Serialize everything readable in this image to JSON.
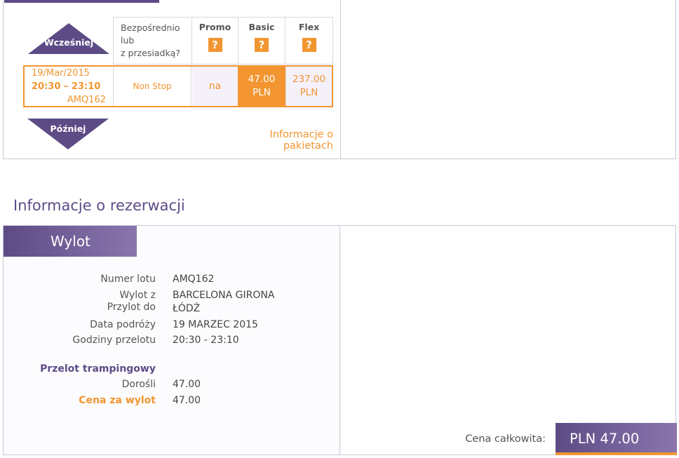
{
  "flight_selector": {
    "earlier_label": "Wcześniej",
    "later_label": "Później",
    "columns": {
      "direct_header": [
        "Bezpośrednio",
        "lub",
        "z przesiadką?"
      ],
      "promo": "Promo",
      "basic": "Basic",
      "flex": "Flex",
      "help_symbol": "?"
    },
    "flight": {
      "date": "19/Mar/2015",
      "time": "20:30 – 23:10",
      "number": "AMQ162",
      "stops": "Non Stop",
      "promo_price": "na",
      "basic_price": "47.00",
      "basic_currency": "PLN",
      "flex_price": "237.00",
      "flex_currency": "PLN"
    },
    "package_info_link": "Informacje o pakietach"
  },
  "booking": {
    "section_title": "Informacje o rezerwacji",
    "tab_label": "Wylot",
    "rows": {
      "flight_number_label": "Numer lotu",
      "flight_number_value": "AMQ162",
      "from_label": "Wylot z",
      "from_value": "BARCELONA GIRONA",
      "to_label": "Przylot do",
      "to_value": "ŁÓDŹ",
      "date_label": "Data podróży",
      "date_value": "19 MARZEC 2015",
      "hours_label": "Godziny przelotu",
      "hours_value": "20:30 - 23:10",
      "fare_type_label": "Przelot trampingowy",
      "adults_label": "Dorośli",
      "adults_value": "47.00",
      "price_label": "Cena za wylot",
      "price_value": "47.00"
    },
    "total_label": "Cena całkowita:",
    "total_value": "PLN 47.00"
  },
  "colors": {
    "brand_purple": "#5d4b86",
    "accent_orange": "#f29530"
  }
}
